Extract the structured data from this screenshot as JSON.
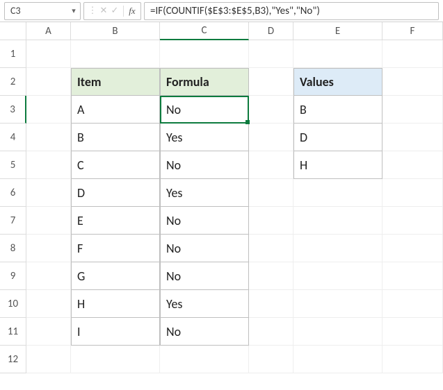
{
  "name_box": "C3",
  "formula": "=IF(COUNTIF($E$3:$E$5,B3),\"Yes\",\"No\")",
  "columns": [
    "A",
    "B",
    "C",
    "D",
    "E",
    "F"
  ],
  "rows": [
    "1",
    "2",
    "3",
    "4",
    "5",
    "6",
    "7",
    "8",
    "9",
    "10",
    "11",
    "12"
  ],
  "headers": {
    "item": "Item",
    "formula": "Formula",
    "values": "Values"
  },
  "table_main": [
    {
      "item": "A",
      "formula": "No"
    },
    {
      "item": "B",
      "formula": "Yes"
    },
    {
      "item": "C",
      "formula": "No"
    },
    {
      "item": "D",
      "formula": "Yes"
    },
    {
      "item": "E",
      "formula": "No"
    },
    {
      "item": "F",
      "formula": "No"
    },
    {
      "item": "G",
      "formula": "No"
    },
    {
      "item": "H",
      "formula": "Yes"
    },
    {
      "item": "I",
      "formula": "No"
    }
  ],
  "table_values": [
    "B",
    "D",
    "H"
  ],
  "selected_cell": "C3",
  "chart_data": {
    "type": "table",
    "tables": [
      {
        "name": "main",
        "columns": [
          "Item",
          "Formula"
        ],
        "rows": [
          [
            "A",
            "No"
          ],
          [
            "B",
            "Yes"
          ],
          [
            "C",
            "No"
          ],
          [
            "D",
            "Yes"
          ],
          [
            "E",
            "No"
          ],
          [
            "F",
            "No"
          ],
          [
            "G",
            "No"
          ],
          [
            "H",
            "Yes"
          ],
          [
            "I",
            "No"
          ]
        ]
      },
      {
        "name": "values",
        "columns": [
          "Values"
        ],
        "rows": [
          [
            "B"
          ],
          [
            "D"
          ],
          [
            "H"
          ]
        ]
      }
    ]
  }
}
